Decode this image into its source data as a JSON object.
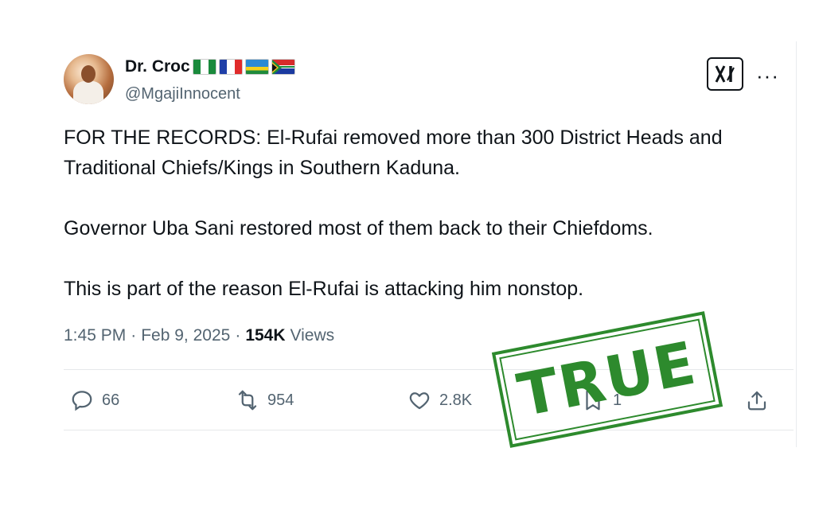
{
  "user": {
    "display_name": "Dr. Croc",
    "handle": "@MgajiInnocent",
    "flags": [
      "nigeria-flag",
      "france-flag",
      "rwanda-flag",
      "south-africa-flag"
    ]
  },
  "header_actions": {
    "grok_icon": "xai-icon",
    "more": "···"
  },
  "tweet": {
    "paragraphs": [
      "FOR THE RECORDS: El-Rufai removed more than 300 District Heads and Traditional Chiefs/Kings in Southern Kaduna.",
      "Governor Uba Sani restored most of them back to their Chiefdoms.",
      "This is part of the reason El-Rufai is attacking him nonstop."
    ],
    "time": "1:45 PM",
    "date": "Feb 9, 2025",
    "views_count": "154K",
    "views_label": "Views",
    "separator": "·"
  },
  "actions": {
    "replies": "66",
    "reposts": "954",
    "likes": "2.8K",
    "bookmarks": "1"
  },
  "stamp": {
    "text": "TRUE",
    "color": "#2d8a2d"
  },
  "colors": {
    "text": "#0f1419",
    "muted": "#536471"
  }
}
